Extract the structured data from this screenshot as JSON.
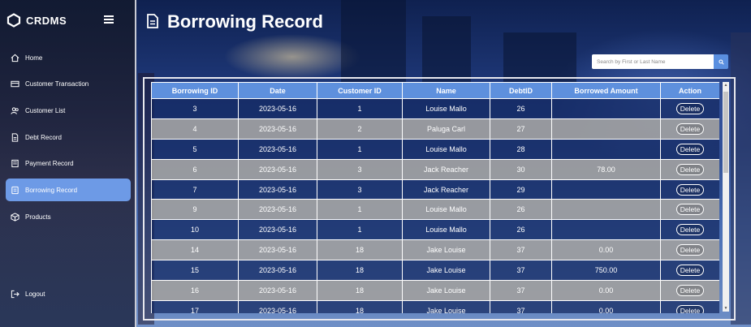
{
  "brand": {
    "name": "CRDMS"
  },
  "sidebar": {
    "items": [
      {
        "label": "Home",
        "icon": "home-icon",
        "active": false
      },
      {
        "label": "Customer Transaction",
        "icon": "transaction-icon",
        "active": false
      },
      {
        "label": "Customer List",
        "icon": "users-icon",
        "active": false
      },
      {
        "label": "Debt Record",
        "icon": "document-icon",
        "active": false
      },
      {
        "label": "Payment Record",
        "icon": "payment-icon",
        "active": false
      },
      {
        "label": "Borrowing Record",
        "icon": "record-icon",
        "active": true
      },
      {
        "label": "Products",
        "icon": "box-icon",
        "active": false
      }
    ],
    "logout": {
      "label": "Logout",
      "icon": "logout-icon"
    }
  },
  "header": {
    "title": "Borrowing Record"
  },
  "search": {
    "placeholder": "Search by First or Last Name"
  },
  "table": {
    "columns": [
      "Borrowing ID",
      "Date",
      "Customer ID",
      "Name",
      "DebtID",
      "Borrowed Amount",
      "Action"
    ],
    "action_label": "Delete",
    "rows": [
      [
        "3",
        "2023-05-16",
        "1",
        "Louise Mallo",
        "26",
        ""
      ],
      [
        "4",
        "2023-05-16",
        "2",
        "Paluga Carl",
        "27",
        ""
      ],
      [
        "5",
        "2023-05-16",
        "1",
        "Louise Mallo",
        "28",
        ""
      ],
      [
        "6",
        "2023-05-16",
        "3",
        "Jack Reacher",
        "30",
        "78.00"
      ],
      [
        "7",
        "2023-05-16",
        "3",
        "Jack Reacher",
        "29",
        ""
      ],
      [
        "9",
        "2023-05-16",
        "1",
        "Louise Mallo",
        "26",
        ""
      ],
      [
        "10",
        "2023-05-16",
        "1",
        "Louise Mallo",
        "26",
        ""
      ],
      [
        "14",
        "2023-05-16",
        "18",
        "Jake Louise",
        "37",
        "0.00"
      ],
      [
        "15",
        "2023-05-16",
        "18",
        "Jake Louise",
        "37",
        "750.00"
      ],
      [
        "16",
        "2023-05-16",
        "18",
        "Jake Louise",
        "37",
        "0.00"
      ],
      [
        "17",
        "2023-05-16",
        "18",
        "Jake Louise",
        "37",
        "0.00"
      ]
    ]
  },
  "colors": {
    "accent": "#5e90dd",
    "active_nav": "#6d9ae6"
  }
}
